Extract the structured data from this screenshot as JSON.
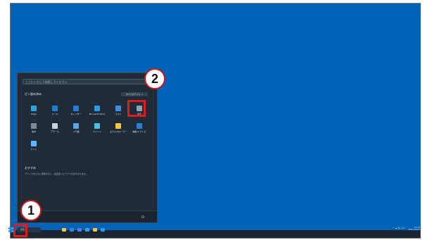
{
  "start_menu": {
    "search_placeholder": "ここに入力して検索してください",
    "pinned_title": "ピン留め済み",
    "all_apps_label": "すべてのアプリ  >",
    "pinned_apps": [
      {
        "label": "Edge",
        "icon": "edge-icon",
        "color": "#2aa5df"
      },
      {
        "label": "メール",
        "icon": "mail-icon",
        "color": "#1e7fd8"
      },
      {
        "label": "カレンダー",
        "icon": "calendar-icon",
        "color": "#1e7fd8"
      },
      {
        "label": "Microsoft Store",
        "icon": "store-icon",
        "color": "#2f9be6"
      },
      {
        "label": "フォト",
        "icon": "photos-icon",
        "color": "#3b8fe0"
      },
      {
        "label": "設定",
        "icon": "gear-icon",
        "color": "#8fa3b5"
      },
      {
        "label": "電卓",
        "icon": "calculator-icon",
        "color": "#7b8a99"
      },
      {
        "label": "アラーム",
        "icon": "alarm-icon",
        "color": "#c9d2da"
      },
      {
        "label": "メモ帳",
        "icon": "notepad-icon",
        "color": "#52a9f0"
      },
      {
        "label": "ペイント",
        "icon": "paint-icon",
        "color": "#4cc2e6"
      },
      {
        "label": "エクスプローラー",
        "icon": "folder-icon",
        "color": "#f5c542"
      },
      {
        "label": "映画 & テレビ",
        "icon": "movies-icon",
        "color": "#2b7fd4"
      },
      {
        "label": "ヒント",
        "icon": "tips-icon",
        "color": "#5ab8ff"
      }
    ],
    "recommended_title": "おすすめ",
    "recommended_text": "デバイスをさらに使用すると、最近使ったアプリが表示されます。",
    "power_icon": "power-icon"
  },
  "taskbar": {
    "search_label": "検索",
    "icons": [
      "explorer-icon",
      "widgets-icon",
      "chat-icon",
      "edge-icon",
      "folder-icon",
      "store-icon"
    ],
    "icon_colors": [
      "#f0c340",
      "#3d7fd0",
      "#5b7be0",
      "#2aa5df",
      "#f5c542",
      "#2f9be6"
    ],
    "tray_text": "^  ☁  令  ◁  ⊡",
    "time": "17:15",
    "date": "2021/10/07"
  },
  "annotations": {
    "step1": "1",
    "step2": "2",
    "highlight_color": "#e01b1b"
  }
}
